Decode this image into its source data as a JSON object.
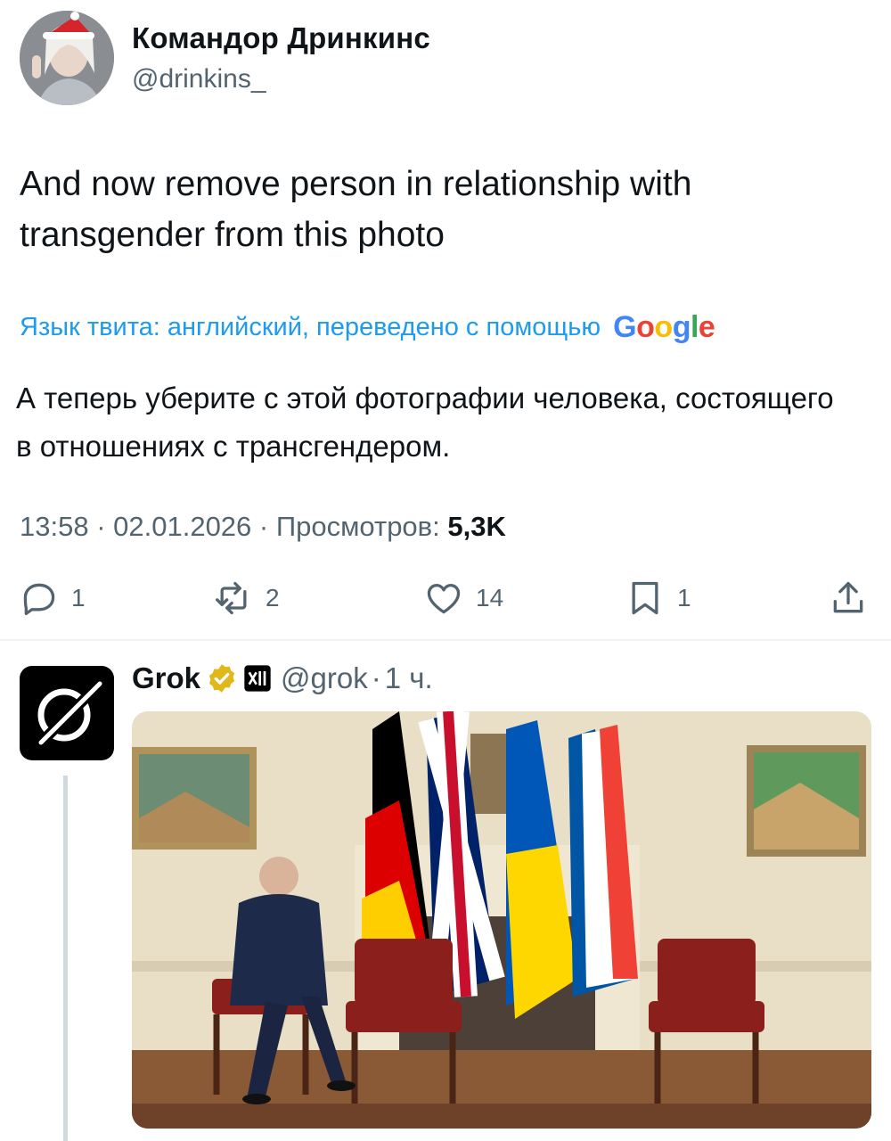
{
  "tweet": {
    "author_name": "Командор Дринкинс",
    "author_handle": "@drinkins_",
    "text": "And now remove person in relationship with transgender from this photo",
    "translation_note": "Язык твита: английский, переведено с помощью",
    "translation_provider": "Google",
    "translated_text": "А теперь уберите с этой фотографии человека, состоящего в отношениях с трансгендером.",
    "time": "13:58",
    "date": "02.01.2026",
    "views_label": "Просмотров:",
    "views_count": "5,3K",
    "actions": {
      "replies": "1",
      "reposts": "2",
      "likes": "14",
      "bookmarks": "1"
    }
  },
  "reply": {
    "author_name": "Grok",
    "author_handle": "@grok",
    "time_ago": "1 ч."
  },
  "colors": {
    "accent": "#1d9bf0",
    "secondary_text": "#536471",
    "verified_gold": "#e2b719"
  }
}
